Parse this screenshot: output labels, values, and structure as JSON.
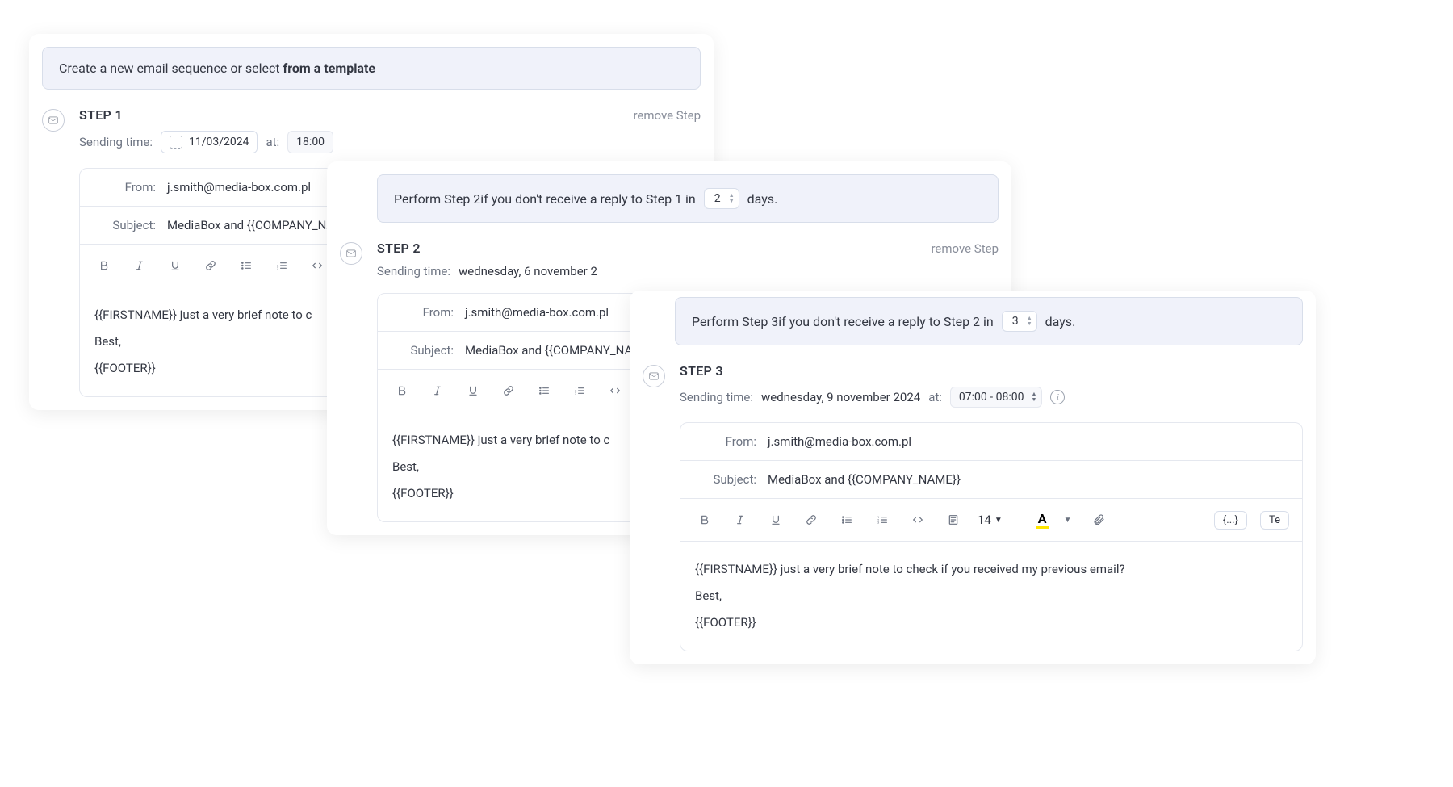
{
  "topBanner": {
    "prefix": "Create a new email sequence or select ",
    "link": "from a template"
  },
  "step1": {
    "title": "STEP 1",
    "remove": "remove Step",
    "sendingLabel": "Sending time:",
    "date": "11/03/2024",
    "atLabel": "at:",
    "time": "18:00",
    "fromLabel": "From:",
    "from": "j.smith@media-box.com.pl",
    "subjectLabel": "Subject:",
    "subject": "MediaBox and {{COMPANY_NAME}}",
    "bodyLine1": "{{FIRSTNAME}} just a very brief note to c",
    "bodyLine2": "Best,",
    "bodyLine3": "{{FOOTER}}"
  },
  "step2": {
    "bannerPrefix": "Perform Step 2",
    "bannerMid": "if you don't receive a reply to Step 1 in",
    "days": "2",
    "bannerSuffix": "days.",
    "title": "STEP 2",
    "remove": "remove Step",
    "sendingLabel": "Sending time:",
    "sendingValue": "wednesday, 6 november 2",
    "fromLabel": "From:",
    "from": "j.smith@media-box.com.pl",
    "subjectLabel": "Subject:",
    "subject": "MediaBox and {{COMPANY_NAME}}",
    "bodyLine1": "{{FIRSTNAME}} just a very brief note to c",
    "bodyLine2": "Best,",
    "bodyLine3": "{{FOOTER}}"
  },
  "step3": {
    "bannerPrefix": "Perform Step 3",
    "bannerMid": "if you don't receive a reply to Step 2 in",
    "days": "3",
    "bannerSuffix": "days.",
    "title": "STEP 3",
    "sendingLabel": "Sending time:",
    "sendingValue": "wednesday, 9 november 2024",
    "atLabel": "at:",
    "timeRange": "07:00 - 08:00",
    "fromLabel": "From:",
    "from": "j.smith@media-box.com.pl",
    "subjectLabel": "Subject:",
    "subject": "MediaBox and {{COMPANY_NAME}}",
    "fontSize": "14",
    "bracesBtn": "{...}",
    "teBtn": "Te",
    "bodyLine1": "{{FIRSTNAME}} just a very brief note to check if you received my previous email?",
    "bodyLine2": "Best,",
    "bodyLine3": "{{FOOTER}}"
  }
}
